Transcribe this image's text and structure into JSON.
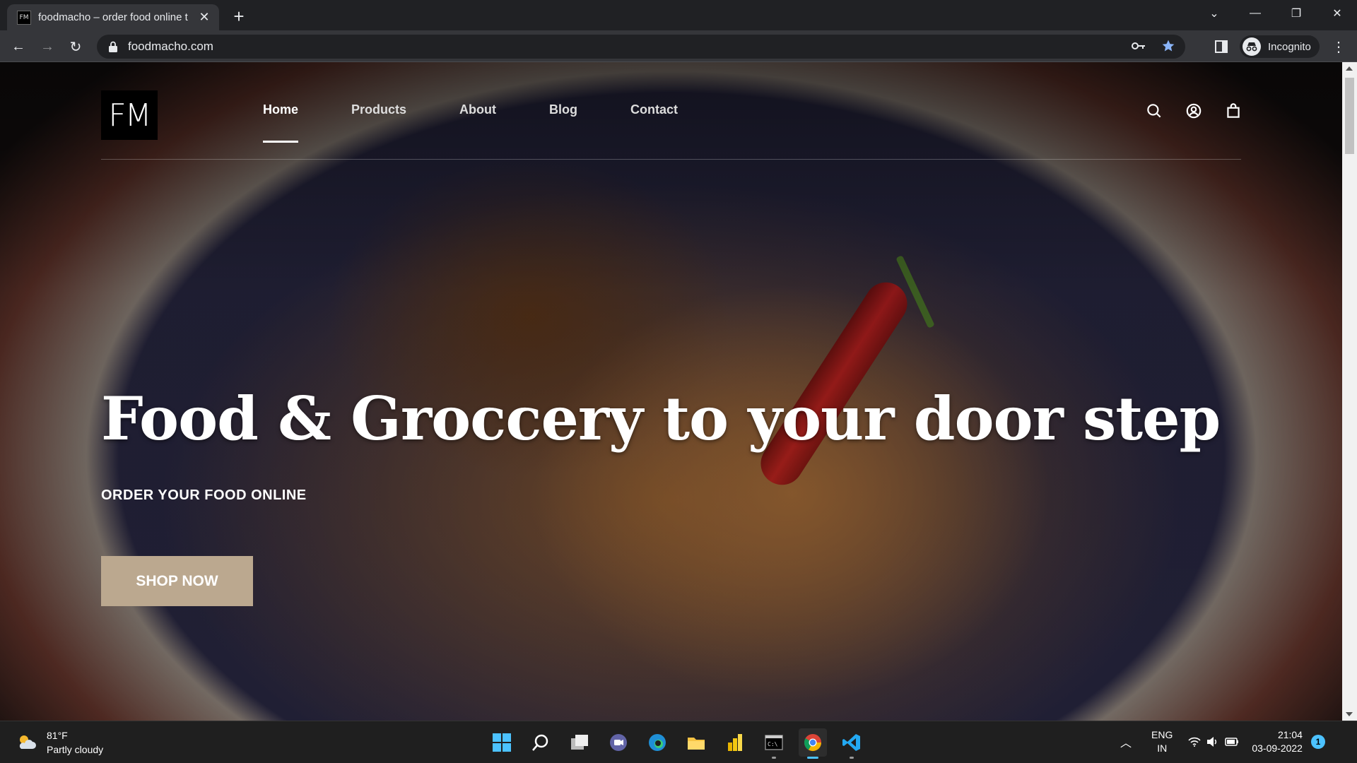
{
  "browser": {
    "tab_title": "foodmacho – order food online t",
    "tab_favicon_text": "FM",
    "url": "foodmacho.com",
    "profile_label": "Incognito"
  },
  "site": {
    "logo_text": "FM",
    "nav": [
      {
        "label": "Home",
        "active": true
      },
      {
        "label": "Products",
        "active": false
      },
      {
        "label": "About",
        "active": false
      },
      {
        "label": "Blog",
        "active": false
      },
      {
        "label": "Contact",
        "active": false
      }
    ],
    "hero_title": "Food & Groccery to your door step",
    "hero_subtitle": "ORDER YOUR FOOD ONLINE",
    "cta_label": "SHOP NOW",
    "cta_color": "#bba88f"
  },
  "taskbar": {
    "weather_temp": "81°F",
    "weather_desc": "Partly cloudy",
    "lang_top": "ENG",
    "lang_bottom": "IN",
    "time": "21:04",
    "date": "03-09-2022",
    "notification_count": "1",
    "apps": [
      "start-icon",
      "search-icon",
      "task-view-icon",
      "teams-chat-icon",
      "edge-icon",
      "file-explorer-icon",
      "power-bi-icon",
      "terminal-icon",
      "chrome-icon",
      "vscode-icon"
    ]
  }
}
